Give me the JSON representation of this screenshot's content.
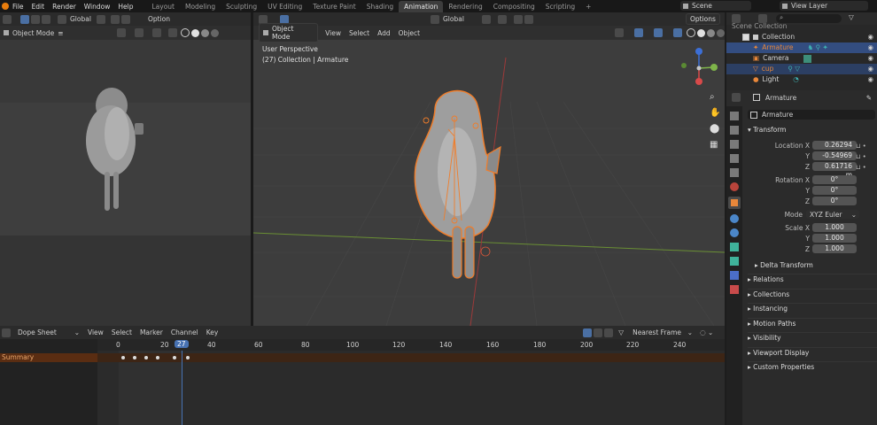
{
  "topbar": {
    "menus": [
      "File",
      "Edit",
      "Render",
      "Window",
      "Help"
    ],
    "workspaces": [
      "Layout",
      "Modeling",
      "Sculpting",
      "UV Editing",
      "Texture Paint",
      "Shading",
      "Animation",
      "Rendering",
      "Compositing",
      "Scripting"
    ],
    "active_workspace": "Animation",
    "add_tab": "+",
    "scene_label": "Scene",
    "view_layer_label": "View Layer"
  },
  "left_viewport": {
    "orientation": "Global",
    "options": "Option",
    "mode": "Object Mode"
  },
  "main_viewport": {
    "orientation": "Global",
    "options": "Options",
    "mode": "Object Mode",
    "menu": [
      "View",
      "Select",
      "Add",
      "Object"
    ],
    "overlay_title": "User Perspective",
    "overlay_subtitle": "(27) Collection | Armature"
  },
  "outliner": {
    "search_placeholder": "",
    "scene_collection": "Scene Collection",
    "collection": "Collection",
    "items": [
      {
        "label": "Armature",
        "selected": true,
        "color": "#e8873a"
      },
      {
        "label": "Camera",
        "selected": false,
        "color": "#d9d9d9"
      },
      {
        "label": "cup",
        "selected": true,
        "color": "#e8873a"
      },
      {
        "label": "Light",
        "selected": false,
        "color": "#d9d9d9"
      }
    ]
  },
  "properties": {
    "object_name_header": "Armature",
    "object_name_field": "Armature",
    "transform_title": "Transform",
    "location_label": "Location X",
    "location": [
      "0.26294 m",
      "-0.54969 m",
      "0.61716 m"
    ],
    "rotation_label": "Rotation X",
    "rotation": [
      "0°",
      "0°",
      "0°"
    ],
    "mode_label": "Mode",
    "mode_value": "XYZ Euler",
    "scale_label": "Scale X",
    "scale": [
      "1.000",
      "1.000",
      "1.000"
    ],
    "axis_y": "Y",
    "axis_z": "Z",
    "delta_transform": "Delta Transform",
    "sections": [
      "Relations",
      "Collections",
      "Instancing",
      "Motion Paths",
      "Visibility",
      "Viewport Display",
      "Custom Properties"
    ]
  },
  "dopesheet": {
    "editor_type": "Dope Sheet",
    "menu": [
      "View",
      "Select",
      "Marker",
      "Channel",
      "Key"
    ],
    "snap": "Nearest Frame",
    "frame_labels": [
      "0",
      "20",
      "40",
      "60",
      "80",
      "100",
      "120",
      "140",
      "160",
      "180",
      "200",
      "220",
      "240"
    ],
    "current_frame": "27",
    "summary_label": "Summary",
    "keyframes": [
      0,
      5,
      10,
      15,
      20,
      25,
      30
    ]
  },
  "colors": {
    "accent": "#4772b3",
    "selection_orange": "#e8873a",
    "active_tab": "#3d3d3d"
  }
}
